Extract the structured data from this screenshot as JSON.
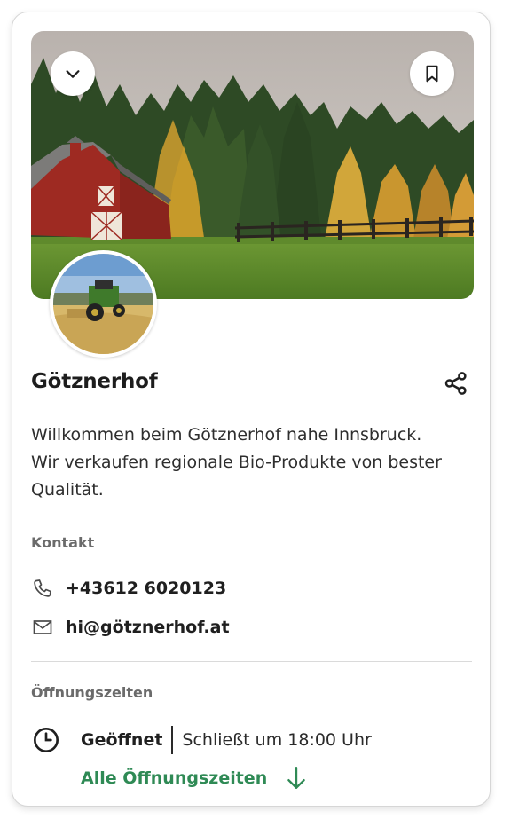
{
  "farm": {
    "name": "Götznerhof",
    "description": "Willkommen beim Götznerhof nahe Innsbruck. Wir verkaufen regionale Bio-Produkte von bester Qualität."
  },
  "icons": {
    "collapse": "chevron-down-icon",
    "bookmark": "bookmark-icon",
    "share": "share-icon",
    "phone": "phone-icon",
    "email": "mail-icon",
    "clock": "clock-icon",
    "arrow": "arrow-down-icon"
  },
  "contact": {
    "label": "Kontakt",
    "phone": "+43612 6020123",
    "email": "hi@götznerhof.at"
  },
  "hours": {
    "label": "Öffnungszeiten",
    "status": "Geöffnet",
    "closes": "Schließt um 18:00 Uhr",
    "all_hours_link": "Alle Öffnungszeiten"
  },
  "colors": {
    "accent": "#2f8a55",
    "text": "#1f1f1f",
    "muted": "#6b6b6b",
    "divider": "#dadada"
  }
}
